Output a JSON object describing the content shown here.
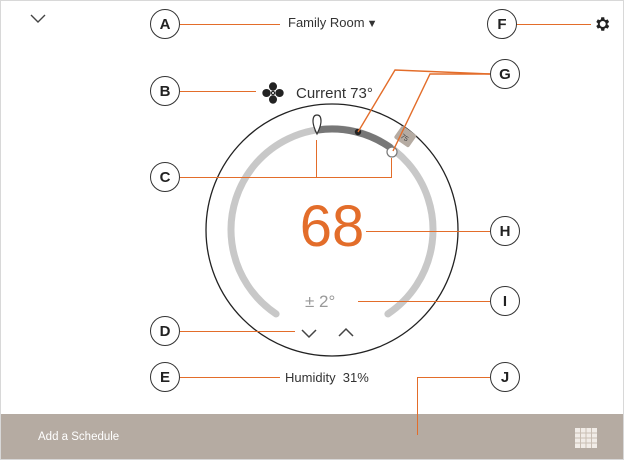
{
  "header": {
    "location_label": "Family Room",
    "location_caret": "▼",
    "collapse_icon": "chevron-down-icon",
    "settings_icon": "gear-icon"
  },
  "status": {
    "fan_icon": "fan-icon",
    "current_label": "Current 73°"
  },
  "dial": {
    "setpoint": "68",
    "range_label": "± 2°",
    "marker_label": "75",
    "current_temp": 73,
    "down_icon": "chevron-down-icon",
    "up_icon": "chevron-up-icon"
  },
  "humidity": {
    "label": "Humidity  31%"
  },
  "footer": {
    "schedule_label": "Add a Schedule",
    "schedule_icon": "calendar-grid-icon"
  },
  "callouts": [
    "A",
    "B",
    "C",
    "D",
    "E",
    "F",
    "G",
    "H",
    "I",
    "J"
  ],
  "colors": {
    "accent": "#e36d2a",
    "arc_track": "#c8c8c8",
    "arc_active": "#777777",
    "marker": "#b5aba2",
    "footer_bg": "#b5aba2",
    "text": "#333333"
  }
}
